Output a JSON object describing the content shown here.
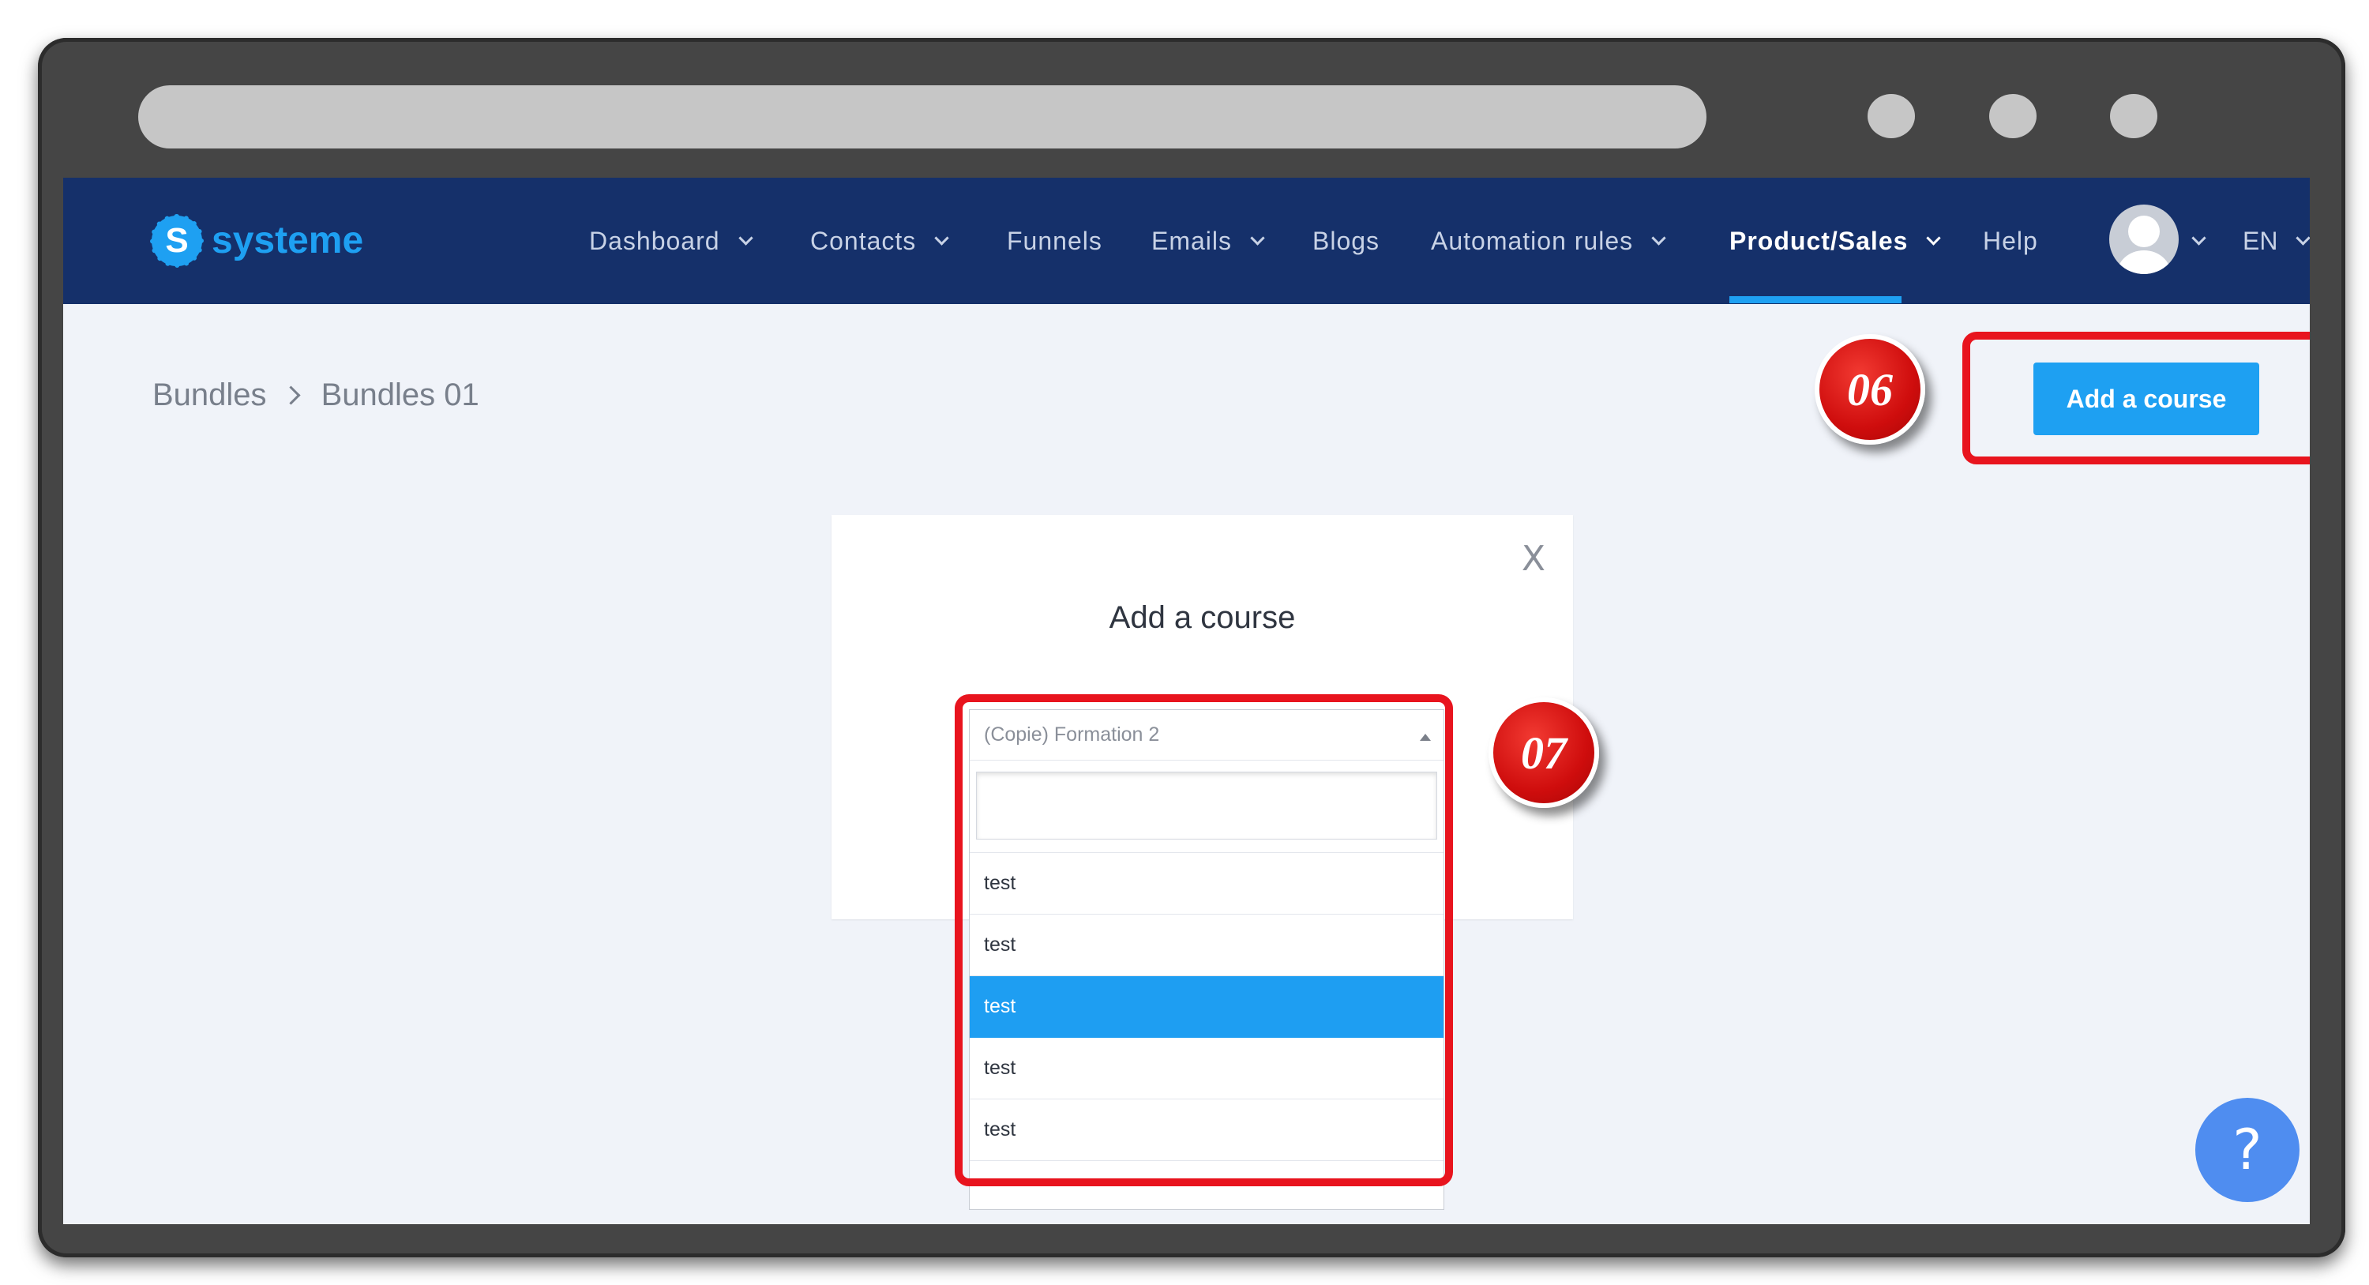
{
  "nav": {
    "logo_text": "systeme",
    "logo_glyph": "S",
    "items": [
      {
        "label": "Dashboard",
        "dropdown": true
      },
      {
        "label": "Contacts",
        "dropdown": true
      },
      {
        "label": "Funnels",
        "dropdown": false
      },
      {
        "label": "Emails",
        "dropdown": true
      },
      {
        "label": "Blogs",
        "dropdown": false
      },
      {
        "label": "Automation rules",
        "dropdown": true
      },
      {
        "label": "Product/Sales",
        "dropdown": true,
        "active": true
      },
      {
        "label": "Help",
        "dropdown": false
      }
    ],
    "language": "EN"
  },
  "breadcrumb": {
    "parent": "Bundles",
    "current": "Bundles 01"
  },
  "header_action": {
    "label": "Add a course"
  },
  "annotations": {
    "step_a": "06",
    "step_b": "07"
  },
  "modal": {
    "title": "Add a course",
    "close_glyph": "X",
    "select": {
      "selected_value": "(Copie) Formation 2",
      "search_value": "",
      "options": [
        "test",
        "test",
        "test",
        "test",
        "test"
      ],
      "highlighted_index": 2
    }
  },
  "help_button": {
    "glyph": "?"
  },
  "colors": {
    "nav_bg": "#15306a",
    "accent": "#1ea0f2",
    "annotation_red": "#e8141e",
    "page_bg": "#f0f3f9",
    "help_button": "#4f8df0"
  },
  "icons": [
    "logo-icon",
    "chevron-down-icon",
    "avatar-icon",
    "close-icon",
    "caret-up-icon",
    "help-icon"
  ]
}
